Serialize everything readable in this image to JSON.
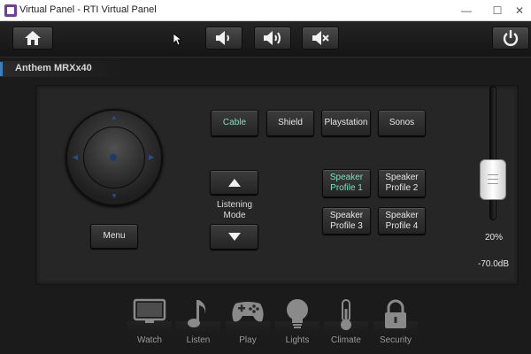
{
  "window": {
    "title": "Virtual Panel - RTI Virtual Panel",
    "minimize_glyph": "—",
    "maximize_glyph": "☐",
    "close_glyph": "✕"
  },
  "toolbar": {
    "home_icon": "home-icon",
    "vol_down_icon": "volume-down-icon",
    "vol_up_icon": "volume-up-icon",
    "mute_icon": "mute-icon",
    "power_icon": "power-icon"
  },
  "zone": {
    "label": "Anthem MRXx40"
  },
  "sources": [
    {
      "label": "Cable",
      "active": true
    },
    {
      "label": "Shield",
      "active": false
    },
    {
      "label": "Playstation",
      "active": false
    },
    {
      "label": "Sonos",
      "active": false
    }
  ],
  "listening_mode": {
    "label": "Listening Mode"
  },
  "profiles": [
    {
      "line1": "Speaker",
      "line2": "Profile 1",
      "active": true
    },
    {
      "line1": "Speaker",
      "line2": "Profile 2",
      "active": false
    },
    {
      "line1": "Speaker",
      "line2": "Profile 3",
      "active": false
    },
    {
      "line1": "Speaker",
      "line2": "Profile 4",
      "active": false
    }
  ],
  "menu_button": {
    "label": "Menu"
  },
  "volume": {
    "percent_text": "20%",
    "db_text": "-70.0dB",
    "level": 0.2
  },
  "bottom_nav": [
    {
      "label": "Watch",
      "icon": "tv-icon"
    },
    {
      "label": "Listen",
      "icon": "music-note-icon"
    },
    {
      "label": "Play",
      "icon": "gamepad-icon"
    },
    {
      "label": "Lights",
      "icon": "lightbulb-icon"
    },
    {
      "label": "Climate",
      "icon": "thermometer-icon"
    },
    {
      "label": "Security",
      "icon": "lock-icon"
    }
  ],
  "colors": {
    "accent_text": "#7fe0c0",
    "zone_marker": "#3a80c0"
  }
}
